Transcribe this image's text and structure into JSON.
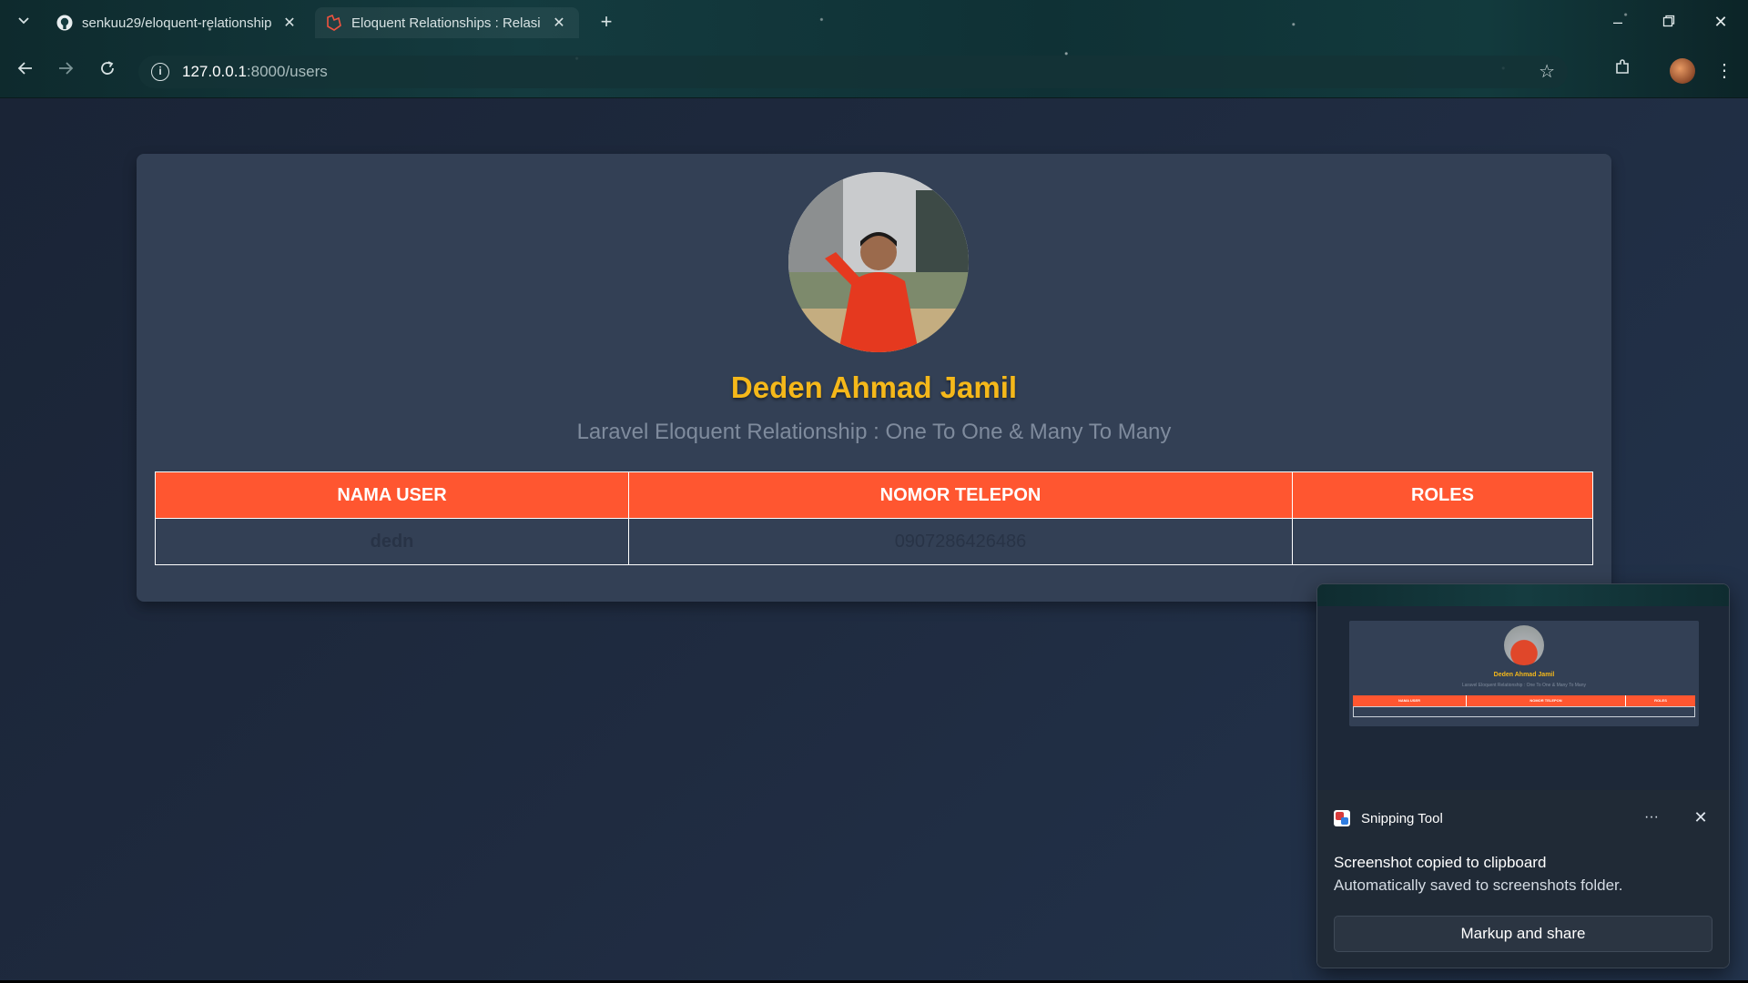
{
  "browser": {
    "tabs": [
      {
        "title": "senkuu29/eloquent-relationship",
        "favicon": "github-icon",
        "active": false
      },
      {
        "title": "Eloquent Relationships : Relasi",
        "favicon": "laravel-icon",
        "active": true
      }
    ],
    "address": {
      "host": "127.0.0.1",
      "path": ":8000/users"
    },
    "window_controls": [
      "minimize-icon",
      "restore-icon",
      "close-icon"
    ]
  },
  "page": {
    "profile": {
      "name": "Deden Ahmad Jamil",
      "subtitle": "Laravel Eloquent Relationship : One To One & Many To Many"
    },
    "table": {
      "headers": [
        "NAMA USER",
        "NOMOR TELEPON",
        "ROLES"
      ],
      "rows": [
        {
          "name": "dedn",
          "phone": "0907286426486",
          "roles": ""
        }
      ]
    },
    "colors": {
      "header_bg": "#ff5630",
      "name_color": "#f5b81a",
      "card_bg": "#334055"
    }
  },
  "toast": {
    "app_name": "Snipping Tool",
    "more_label": "···",
    "title": "Screenshot copied to clipboard",
    "message": "Automatically saved to screenshots folder.",
    "action_label": "Markup and share",
    "preview": {
      "name": "Deden Ahmad Jamil",
      "subtitle": "Laravel Eloquent Relationship : One To One & Many To Many",
      "headers": [
        "NAMA USER",
        "NOMOR TELEPON",
        "ROLES"
      ]
    }
  }
}
